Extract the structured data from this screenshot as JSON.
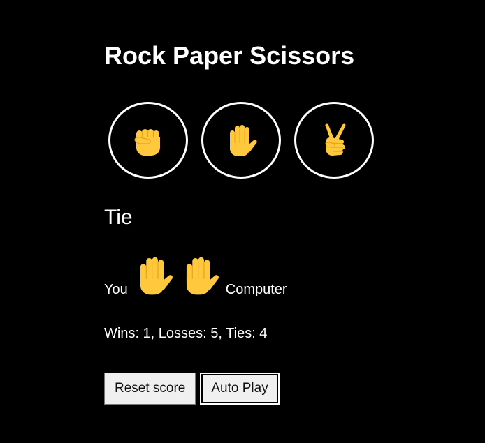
{
  "title": "Rock Paper Scissors",
  "moves": [
    {
      "name": "rock",
      "icon": "raised-fist-icon"
    },
    {
      "name": "paper",
      "icon": "raised-hand-icon"
    },
    {
      "name": "scissors",
      "icon": "victory-hand-icon"
    }
  ],
  "result": "Tie",
  "picks": {
    "you_label": "You",
    "you_move": "paper",
    "computer_move": "paper",
    "computer_label": "Computer"
  },
  "score": {
    "text": "Wins: 1, Losses: 5, Ties: 4"
  },
  "buttons": {
    "reset_label": "Reset score",
    "autoplay_label": "Auto Play"
  },
  "colors": {
    "background": "#000000",
    "text": "#ffffff",
    "emoji_fill": "#FFC83D",
    "emoji_shade": "#E8A317"
  }
}
